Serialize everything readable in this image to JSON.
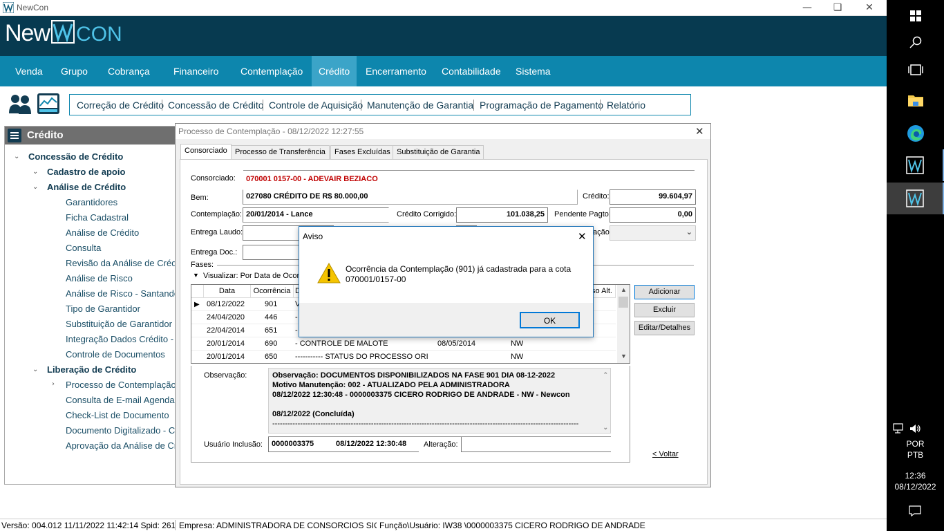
{
  "window": {
    "title": "NewCon"
  },
  "brand": {
    "logo_left": "New",
    "logo_right": "CON"
  },
  "menu": [
    "Venda",
    "Grupo",
    "Cobrança",
    "Financeiro",
    "Contemplação",
    "Crédito",
    "Encerramento",
    "Contabilidade",
    "Sistema"
  ],
  "menu_active": "Crédito",
  "toolbar": [
    "Correção de Crédito",
    "Concessão de Crédito",
    "Controle de Aquisição",
    "Manutenção de Garantia",
    "Programação de Pagamento",
    "Relatório"
  ],
  "left_panel": {
    "title": "Crédito",
    "tree": [
      {
        "label": "Concessão de Crédito",
        "level": 0,
        "bold": true,
        "chevron": "down"
      },
      {
        "label": "Cadastro de apoio",
        "level": 1,
        "bold": true,
        "chevron": "down"
      },
      {
        "label": "Análise de Crédito",
        "level": 1,
        "bold": true,
        "chevron": "down"
      },
      {
        "label": "Garantidores",
        "level": 2
      },
      {
        "label": "Ficha Cadastral",
        "level": 2
      },
      {
        "label": "Análise de Crédito",
        "level": 2
      },
      {
        "label": "Consulta",
        "level": 2
      },
      {
        "label": "Revisão da Análise de Crédit",
        "level": 2
      },
      {
        "label": "Análise de Risco",
        "level": 2
      },
      {
        "label": "Análise de Risco - Santander",
        "level": 2
      },
      {
        "label": "Tipo de Garantidor",
        "level": 2
      },
      {
        "label": "Substituição de Garantidor",
        "level": 2
      },
      {
        "label": "Integração Dados Crédito - In",
        "level": 2
      },
      {
        "label": "Controle de Documentos",
        "level": 2
      },
      {
        "label": "Liberação de Crédito",
        "level": 1,
        "bold": true,
        "chevron": "down"
      },
      {
        "label": "Processo de Contemplação",
        "level": 2,
        "chevron": "right"
      },
      {
        "label": "Consulta de E-mail Agendado",
        "level": 2
      },
      {
        "label": "Check-List de Documento",
        "level": 2
      },
      {
        "label": "Documento Digitalizado - Con",
        "level": 2
      },
      {
        "label": "Aprovação da Análise de Créd",
        "level": 2
      }
    ]
  },
  "dialog": {
    "title": "Processo de Contemplação - 08/12/2022  12:27:55",
    "tabs": [
      "Consorciado",
      "Processo de Transferência",
      "Fases Excluídas",
      "Substituição de Garantia"
    ],
    "fields": {
      "consorciado_label": "Consorciado:",
      "consorciado_value": "070001 0157-00 - ADEVAIR BEZIACO",
      "bem_label": "Bem:",
      "bem_value": "027080   CRÉDITO DE R$ 80.000,00",
      "credito_label": "Crédito:",
      "credito_value": "99.604,97",
      "contemplacao_label": "Contemplação:",
      "contemplacao_value": "20/01/2014 - Lance",
      "credito_corrigido_label": "Crédito Corrigido:",
      "credito_corrigido_value": "101.038,25",
      "pendente_label": "Pendente Pagto:",
      "pendente_value": "0,00",
      "entrega_laudo_label": "Entrega Laudo:",
      "situacao_label_partial": "ação:",
      "entrega_doc_label": "Entrega Doc.:",
      "fases_label": "Fases:",
      "visualizar_label": "Visualizar: Por Data de Ocorr"
    },
    "grid": {
      "columns": [
        "Data",
        "Ocorrência",
        "D",
        "",
        "",
        "so Alt."
      ],
      "rows": [
        {
          "data": "08/12/2022",
          "ocorrencia": "901",
          "descricao": "V",
          "data2": "",
          "usuario": "",
          "selected": true
        },
        {
          "data": "24/04/2020",
          "ocorrencia": "446",
          "descricao": "-",
          "data2": "",
          "usuario": ""
        },
        {
          "data": "22/04/2014",
          "ocorrencia": "651",
          "descricao": "-",
          "data2": "",
          "usuario": ""
        },
        {
          "data": "20/01/2014",
          "ocorrencia": "690",
          "descricao": "- CONTROLE DE MALOTE",
          "data2": "08/05/2014",
          "usuario": "NW"
        },
        {
          "data": "20/01/2014",
          "ocorrencia": "650",
          "descricao": "----------- STATUS DO PROCESSO ORIG",
          "data2": "",
          "usuario": "NW"
        }
      ]
    },
    "buttons": {
      "adicionar": "Adicionar",
      "excluir": "Excluir",
      "editar": "Editar/Detalhes",
      "voltar": "< Voltar"
    },
    "observacao_label": "Observação:",
    "observacao_lines": [
      "Observação: DOCUMENTOS DISPONIBILIZADOS NA FASE 901 DIA 08-12-2022",
      "Motivo Manutenção: 002 - ATUALIZADO PELA ADMINISTRADORA",
      "08/12/2022 12:30:48 - 0000003375 CICERO RODRIGO DE ANDRADE - NW - Newcon",
      "",
      "08/12/2022 (Concluída)",
      "-------------------------------------------------------------------------------------------------------------------------"
    ],
    "usuario_inclusao_label": "Usuário Inclusão:",
    "usuario_inclusao_id": "0000003375",
    "usuario_inclusao_date": "08/12/2022 12:30:48",
    "alteracao_label": "Alteração:"
  },
  "aviso": {
    "title": "Aviso",
    "message_line1": "Ocorrência da Contemplação (901) já cadastrada para a cota",
    "message_line2": "070001/0157-00",
    "ok": "OK"
  },
  "statusbar": {
    "versao": "Versão: 004.012  11/11/2022 11:42:14  Spid: 261",
    "empresa": "Empresa: ADMINISTRADORA DE CONSORCIOS SICREI",
    "funcao": "Função\\Usuário: IW38  \\0000003375 CICERO RODRIGO DE ANDRADE"
  },
  "taskbar": {
    "lang1": "POR",
    "lang2": "PTB",
    "time": "12:36",
    "date": "08/12/2022"
  },
  "colors": {
    "header": "#073a50",
    "menubar": "#0d86ad",
    "menu_active": "#3ba4c8",
    "red_value": "#c00000"
  }
}
